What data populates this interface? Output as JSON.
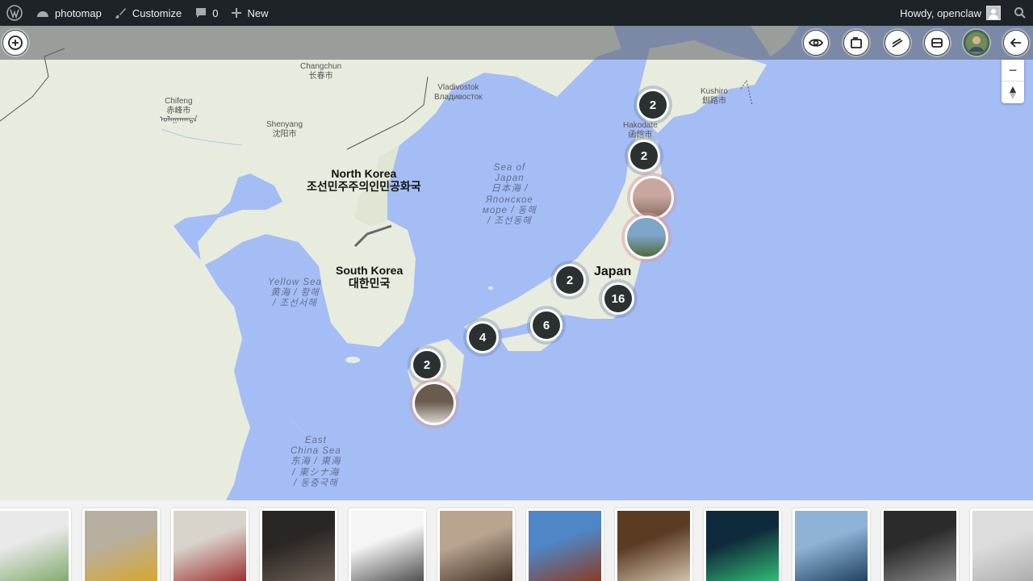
{
  "adminbar": {
    "site_name": "photomap",
    "customize": "Customize",
    "comments_count": "0",
    "new": "New",
    "howdy": "Howdy, openclaw"
  },
  "map_labels": {
    "changchun": "Changchun\n长春市",
    "chifeng": "Chifeng\n赤峰市\nᠤᠯᠠᠭᠠᠨᠬᠠᠳᠠ",
    "shenyang": "Shenyang\n沈阳市",
    "vladivostok": "Vladivostok\nВладивосток",
    "kushiro": "Kushiro\n釧路市",
    "hakodate": "Hakodate\n函館市",
    "north_korea": "North Korea\n조선민주주의인민공화국",
    "south_korea": "South Korea\n대한민국",
    "japan": "Japan",
    "sea_of_japan": "Sea of\nJapan\n日本海 /\nЯпонское\nморе / 동해\n/ 조선동해",
    "yellow_sea": "Yellow Sea\n黄海 / 황해\n/ 조선서해",
    "east_china_sea": "East\nChina Sea\n东海 / 東海\n/ 東シナ海\n/ 동중국해"
  },
  "clusters": [
    {
      "count": "2"
    },
    {
      "count": "2"
    },
    {
      "count": "2"
    },
    {
      "count": "16"
    },
    {
      "count": "6"
    },
    {
      "count": "4"
    },
    {
      "count": "2"
    }
  ],
  "photo_markers": [
    {
      "colors": [
        "#c9a7a0",
        "#8a6e66"
      ]
    },
    {
      "colors": [
        "#7fa5c8",
        "#4f6b3a"
      ]
    },
    {
      "colors": [
        "#6b5a4e",
        "#d6d2cc"
      ]
    }
  ],
  "thumbnails": [
    {
      "colors": [
        "#e9e9e9",
        "#7da86a"
      ]
    },
    {
      "colors": [
        "#b7b0a0",
        "#d8a62b"
      ]
    },
    {
      "colors": [
        "#d8d4cc",
        "#9b2b2b"
      ]
    },
    {
      "colors": [
        "#2a2623",
        "#6e6257"
      ]
    },
    {
      "colors": [
        "#f5f5f5",
        "#4a4a4a"
      ]
    },
    {
      "colors": [
        "#b9a48f",
        "#3e2f25"
      ]
    },
    {
      "colors": [
        "#4f86c6",
        "#8b3a1e"
      ]
    },
    {
      "colors": [
        "#5b3b22",
        "#d7c7b2"
      ]
    },
    {
      "colors": [
        "#0f2a3a",
        "#33c27a"
      ]
    },
    {
      "colors": [
        "#8fb3d6",
        "#1d3d5c"
      ]
    },
    {
      "colors": [
        "#2b2b2b",
        "#8f8f8f"
      ]
    },
    {
      "colors": [
        "#dcdcdc",
        "#a8a8a8"
      ]
    }
  ]
}
